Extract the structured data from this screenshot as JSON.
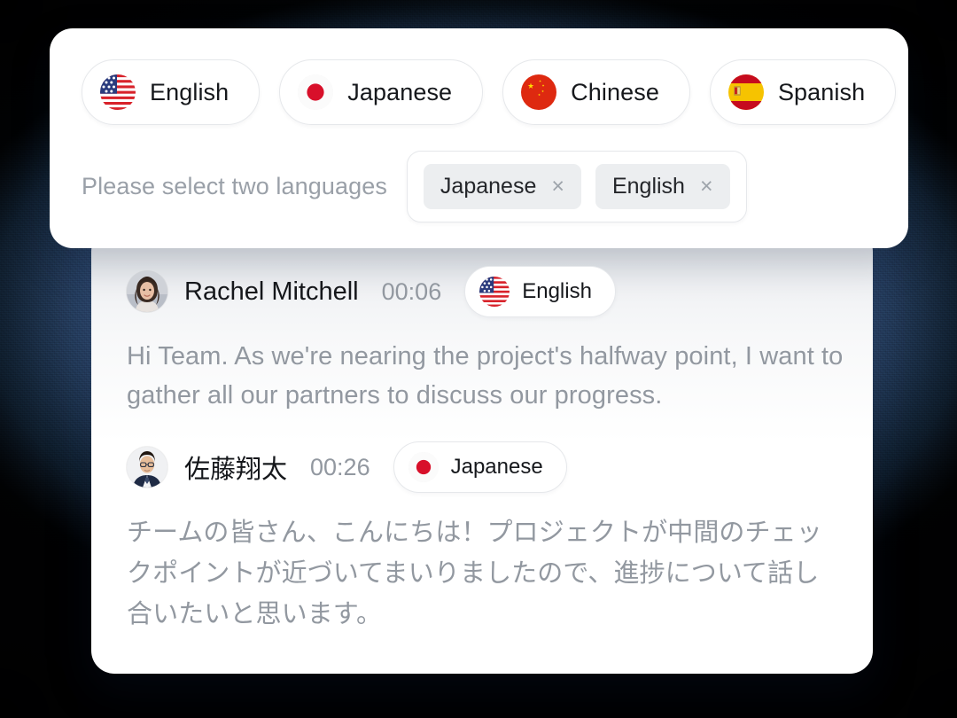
{
  "selector": {
    "languages": [
      {
        "label": "English",
        "flag": "us-flag-icon"
      },
      {
        "label": "Japanese",
        "flag": "jp-flag-icon"
      },
      {
        "label": "Chinese",
        "flag": "cn-flag-icon"
      },
      {
        "label": "Spanish",
        "flag": "es-flag-icon"
      }
    ],
    "hint": "Please select two languages",
    "selected_tags": [
      {
        "label": "Japanese",
        "remove": "×"
      },
      {
        "label": "English",
        "remove": "×"
      }
    ]
  },
  "transcript": {
    "messages": [
      {
        "speaker": "Rachel Mitchell",
        "time": "00:06",
        "language": "English",
        "flag": "us-flag-icon",
        "avatar": "avatar-rachel",
        "text": "Hi Team. As we're nearing the project's halfway point, I want to gather all our partners to discuss our progress."
      },
      {
        "speaker": "佐藤翔太",
        "time": "00:26",
        "language": "Japanese",
        "flag": "jp-flag-icon",
        "avatar": "avatar-sato",
        "text": "チームの皆さん、こんにちは！プロジェクトが中間のチェックポイントが近づいてまいりましたので、進捗について話し合いたいと思います。"
      }
    ]
  },
  "colors": {
    "tag_bg": "#eceef0",
    "muted_text": "#9298a0",
    "primary_text": "#15171b",
    "flag_red": "#d8222a",
    "flag_blue": "#2a3b7d",
    "cn_red": "#de2910",
    "cn_yellow": "#ffde00",
    "es_yellow": "#f6c300",
    "jp_red": "#d8102a"
  }
}
